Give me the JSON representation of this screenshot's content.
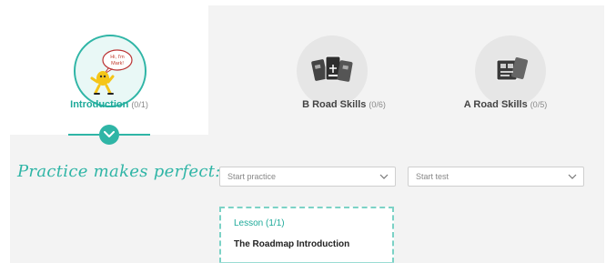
{
  "tabs": [
    {
      "title": "Introduction",
      "count": "(0/1)",
      "icon": "mascot-speech-bubble-icon",
      "active": true
    },
    {
      "title": "B Road Skills",
      "count": "(0/6)",
      "icon": "road-cards-icon",
      "active": false
    },
    {
      "title": "A Road Skills",
      "count": "(0/5)",
      "icon": "road-cards-icon",
      "active": false
    }
  ],
  "mascot_bubble": {
    "line1": "Hi, I'm",
    "line2": "Mark!"
  },
  "practice_heading": "Practice makes perfect:",
  "practice_select": {
    "value": "Start practice"
  },
  "test_select": {
    "value": "Start test"
  },
  "lesson_card": {
    "header": "Lesson (1/1)",
    "title": "The Roadmap Introduction"
  },
  "colors": {
    "accent": "#2fb5a6",
    "tab_inactive": "#e6e6e6",
    "card_border": "#7cd2c6"
  }
}
